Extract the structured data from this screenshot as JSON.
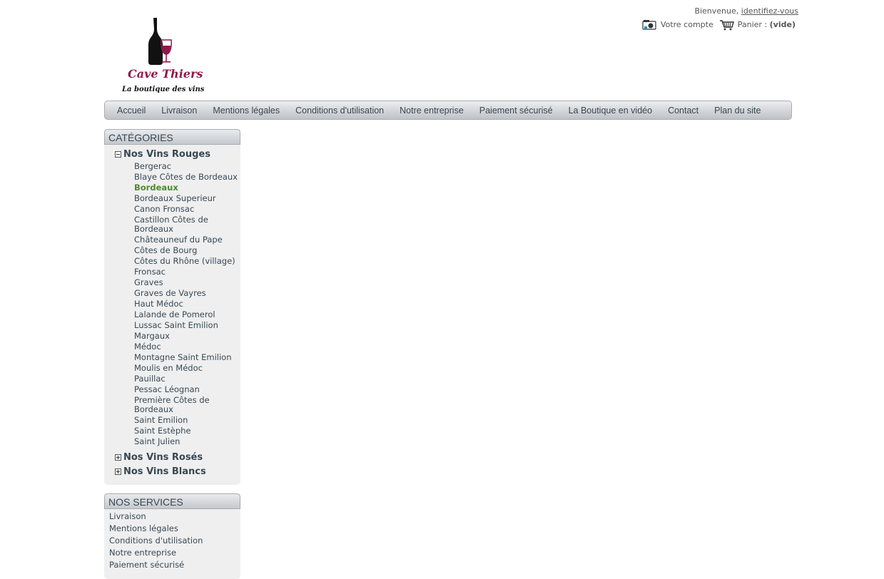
{
  "logo": {
    "title": "Cave Thiers",
    "tagline": "La boutique des vins"
  },
  "header": {
    "welcome_prefix": "Bienvenue,",
    "login_link": "identifiez-vous",
    "account_link": "Votre compte",
    "cart_label": "Panier :",
    "cart_status": "(vide)"
  },
  "nav": {
    "items": [
      {
        "label": "Accueil"
      },
      {
        "label": "Livraison"
      },
      {
        "label": "Mentions légales"
      },
      {
        "label": "Conditions d'utilisation"
      },
      {
        "label": "Notre entreprise"
      },
      {
        "label": "Paiement sécurisé"
      },
      {
        "label": "La Boutique en vidéo"
      },
      {
        "label": "Contact"
      },
      {
        "label": "Plan du site"
      }
    ]
  },
  "categories": {
    "title": "CATÉGORIES",
    "groups": [
      {
        "label": "Nos Vins Rouges",
        "expanded": true,
        "items": [
          {
            "label": "Bergerac"
          },
          {
            "label": "Blaye Côtes de Bordeaux"
          },
          {
            "label": "Bordeaux",
            "active": true
          },
          {
            "label": "Bordeaux Superieur"
          },
          {
            "label": "Canon Fronsac"
          },
          {
            "label": "Castillon Côtes de Bordeaux"
          },
          {
            "label": "Châteauneuf du Pape"
          },
          {
            "label": "Côtes de Bourg"
          },
          {
            "label": "Côtes du Rhône (village)"
          },
          {
            "label": "Fronsac"
          },
          {
            "label": "Graves"
          },
          {
            "label": "Graves de Vayres"
          },
          {
            "label": "Haut Médoc"
          },
          {
            "label": "Lalande de Pomerol"
          },
          {
            "label": "Lussac Saint Emilion"
          },
          {
            "label": "Margaux"
          },
          {
            "label": "Médoc"
          },
          {
            "label": "Montagne Saint Emilion"
          },
          {
            "label": "Moulis en Médoc"
          },
          {
            "label": "Pauillac"
          },
          {
            "label": "Pessac Léognan"
          },
          {
            "label": "Première Côtes de Bordeaux"
          },
          {
            "label": "Saint Emilion"
          },
          {
            "label": "Saint Estèphe"
          },
          {
            "label": "Saint Julien"
          }
        ]
      },
      {
        "label": "Nos Vins Rosés",
        "expanded": false
      },
      {
        "label": "Nos Vins Blancs",
        "expanded": false
      }
    ]
  },
  "services": {
    "title": "NOS SERVICES",
    "items": [
      {
        "label": "Livraison"
      },
      {
        "label": "Mentions légales"
      },
      {
        "label": "Conditions d'utilisation"
      },
      {
        "label": "Notre entreprise"
      },
      {
        "label": "Paiement sécurisé"
      }
    ]
  },
  "icons": {
    "account": "account-icon",
    "cart": "cart-icon",
    "logo": "wine-bottle-glass-icon"
  },
  "colors": {
    "accent_wine": "#8e1a4b",
    "active_link": "#4b8a2e",
    "text": "#374853"
  }
}
